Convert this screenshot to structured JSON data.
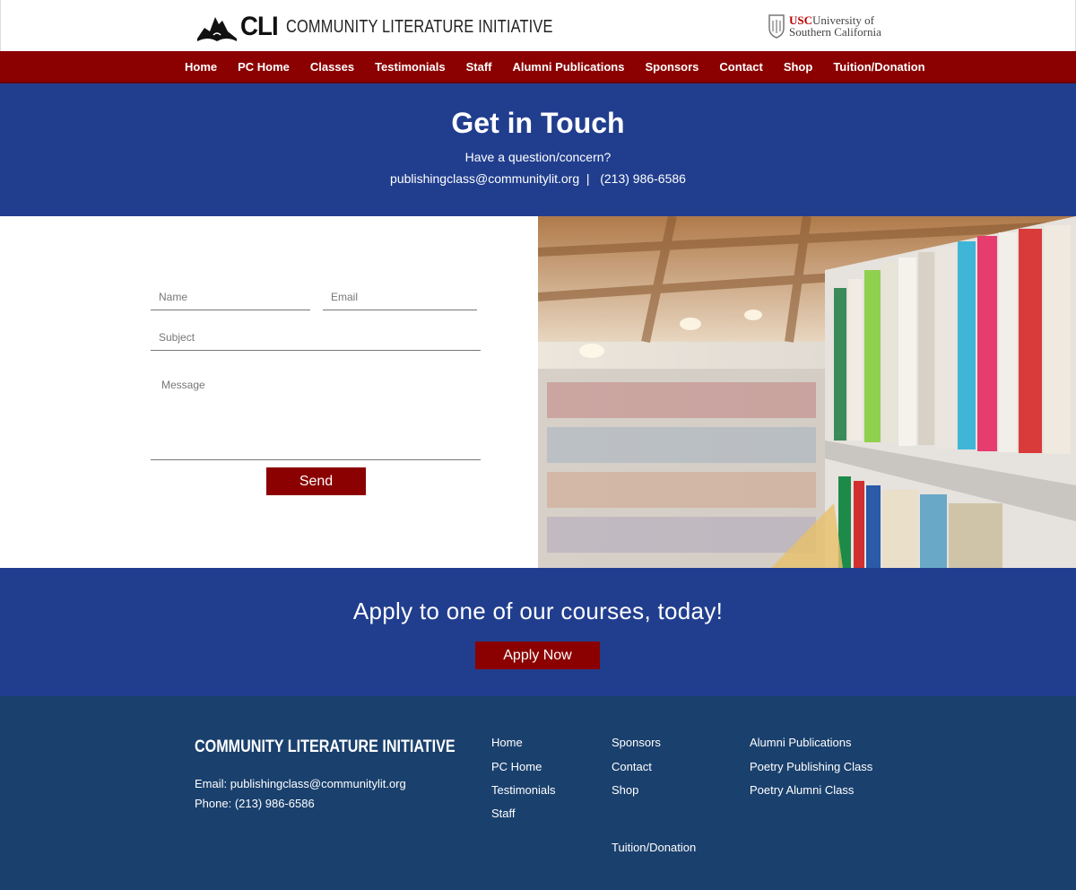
{
  "header": {
    "logo_cli": "CLI",
    "logo_name": "COMMUNITY LITERATURE INITIATIVE",
    "usc_abbr": "USC",
    "usc_line1": "University of",
    "usc_line2": "Southern California"
  },
  "nav": {
    "items": [
      "Home",
      "PC Home",
      "Classes",
      "Testimonials",
      "Staff",
      "Alumni Publications",
      "Sponsors",
      "Contact",
      "Shop",
      "Tuition/Donation"
    ]
  },
  "hero": {
    "title": "Get in Touch",
    "subtitle": "Have a question/concern?",
    "contact": "publishingclass@communitylit.org  |   (213) 986-6586"
  },
  "form": {
    "name_placeholder": "Name",
    "email_placeholder": "Email",
    "subject_placeholder": "Subject",
    "message_placeholder": "Message",
    "send_label": "Send"
  },
  "apply": {
    "text": "Apply to one of our courses, today!",
    "button_label": "Apply Now"
  },
  "footer": {
    "title": "COMMUNITY LITERATURE INITIATIVE",
    "email": "Email: publishingclass@communitylit.org",
    "phone": "Phone: (213) 986-6586",
    "col1": [
      "Home",
      "PC Home",
      "Testimonials",
      "Staff"
    ],
    "col2": [
      "Sponsors",
      "Contact",
      "Shop",
      "Tuition/Donation"
    ],
    "col3": [
      "Alumni Publications",
      "Poetry Publishing Class",
      "Poetry Alumni Class"
    ]
  },
  "colors": {
    "brand_red": "#8b0000",
    "hero_blue": "#213e8e",
    "footer_blue": "#1a406d"
  }
}
